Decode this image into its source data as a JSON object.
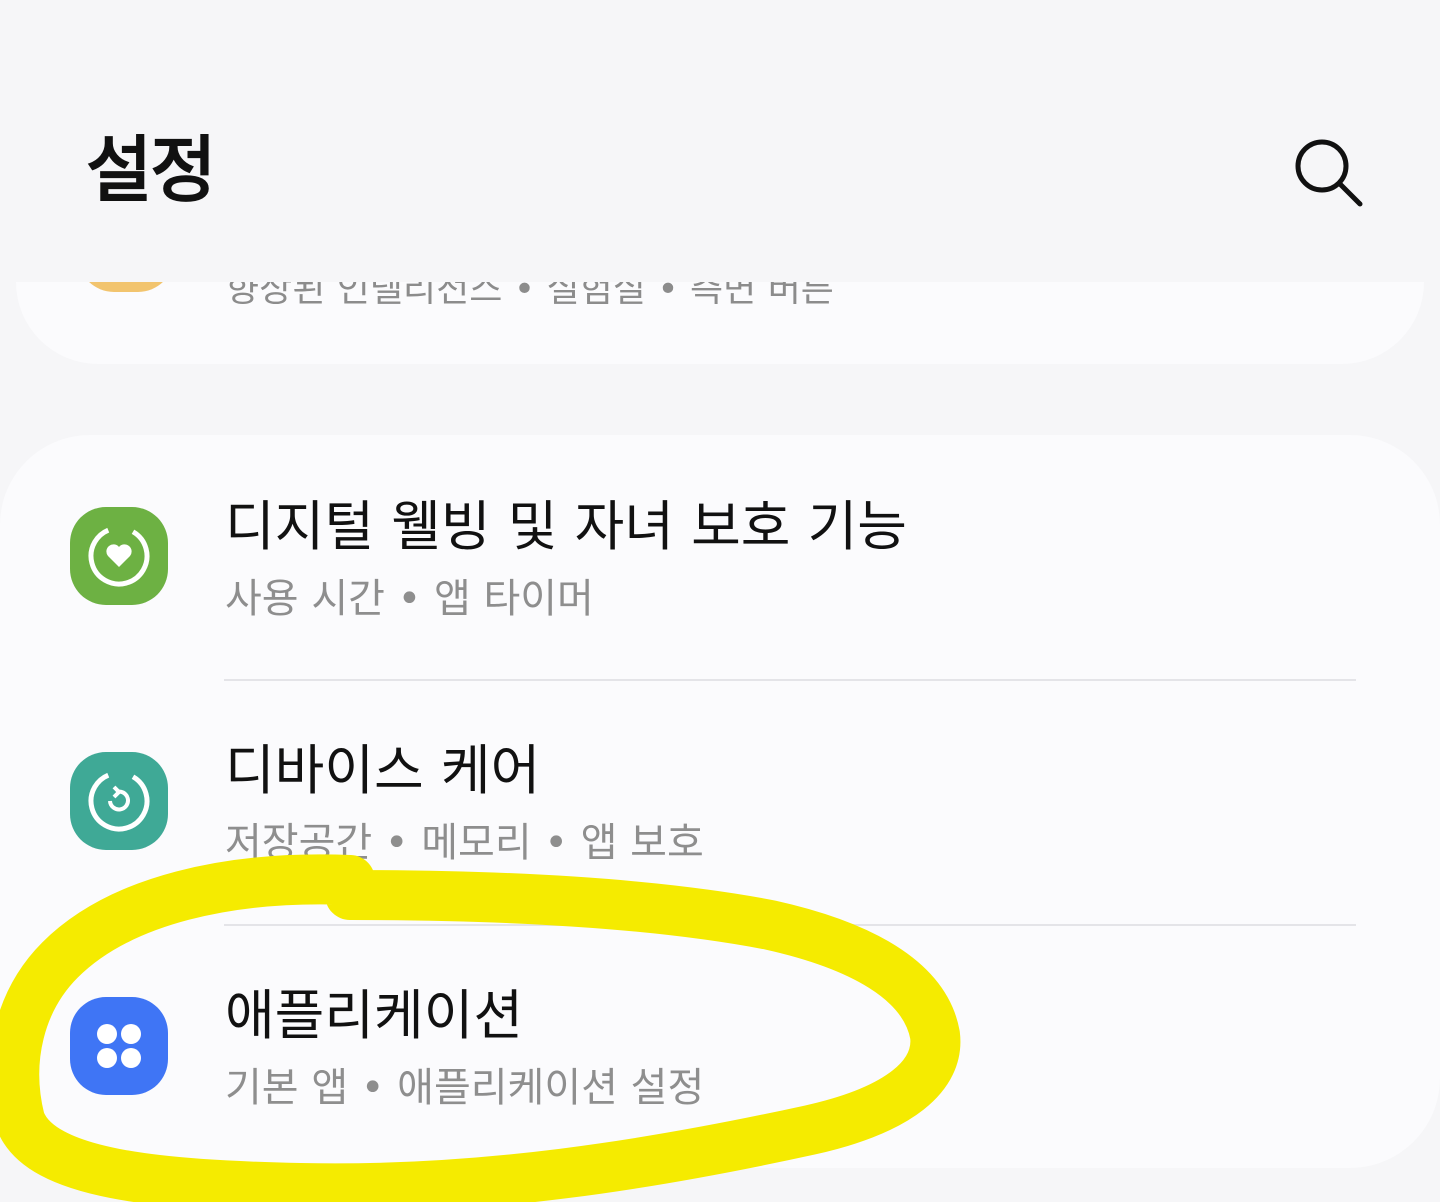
{
  "header": {
    "title": "설정",
    "search_icon": "search-icon"
  },
  "scrolled_card": {
    "subtitle": "향상된 인텔리전스 • 실험실 • 측면 버튼",
    "icon_color": "#f2c46e"
  },
  "settings": [
    {
      "title": "디지털 웰빙 및 자녀 보호 기능",
      "subtitle": "사용 시간 • 앱 타이머",
      "icon": "digital-wellbeing-icon",
      "icon_color": "#6db143"
    },
    {
      "title": "디바이스 케어",
      "subtitle": "저장공간 • 메모리 • 앱 보호",
      "icon": "device-care-icon",
      "icon_color": "#3fa996"
    },
    {
      "title": "애플리케이션",
      "subtitle": "기본 앱 • 애플리케이션 설정",
      "icon": "apps-icon",
      "icon_color": "#3f75f5"
    }
  ],
  "annotation": {
    "type": "yellow-hand-drawn-circle",
    "color": "#f5eb00",
    "target": "애플리케이션"
  }
}
